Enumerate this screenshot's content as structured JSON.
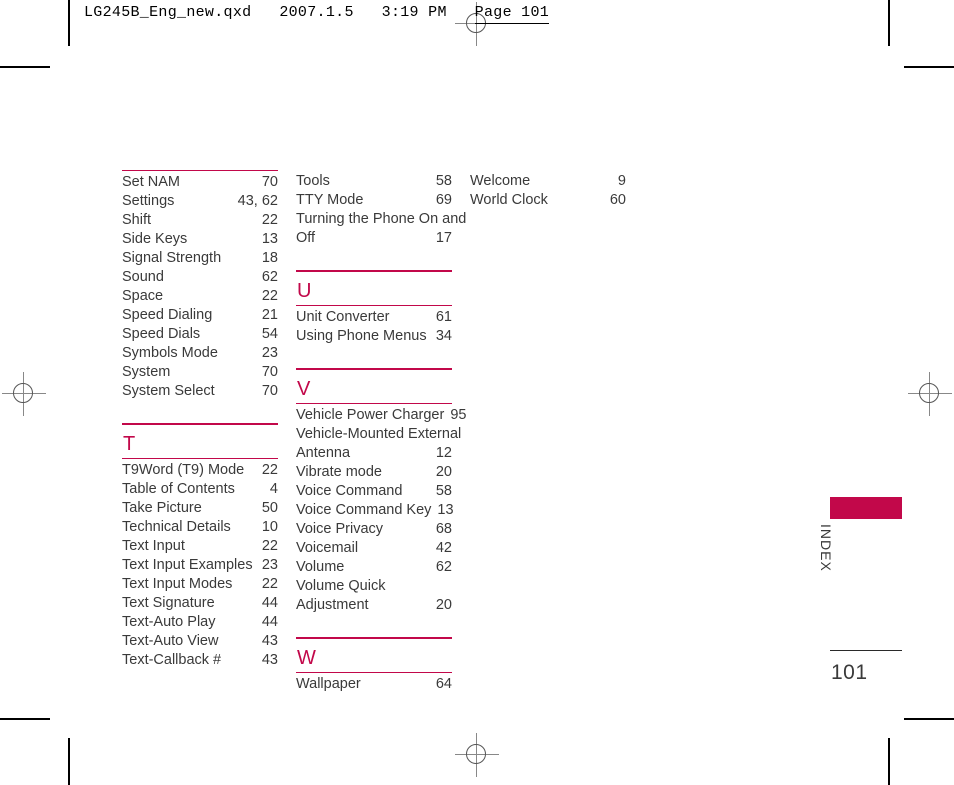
{
  "header": {
    "slug_main": "LG245B_Eng_new.qxd   2007.1.5   3:19 PM",
    "slug_page": "Page 101"
  },
  "sidebar": {
    "tab_label": "INDEX",
    "folio": "101",
    "accent_color": "#C2084A"
  },
  "columns": [
    {
      "blocks": [
        {
          "kind": "entries",
          "top_rule": "thin",
          "entries": [
            {
              "term": "Set NAM",
              "page": "70"
            },
            {
              "term": "Settings",
              "page": "43, 62"
            },
            {
              "term": "Shift",
              "page": "22"
            },
            {
              "term": "Side Keys",
              "page": "13"
            },
            {
              "term": "Signal Strength",
              "page": "18"
            },
            {
              "term": "Sound",
              "page": "62"
            },
            {
              "term": "Space",
              "page": "22"
            },
            {
              "term": "Speed Dialing",
              "page": "21"
            },
            {
              "term": "Speed Dials",
              "page": "54"
            },
            {
              "term": "Symbols Mode",
              "page": "23"
            },
            {
              "term": "System",
              "page": "70"
            },
            {
              "term": "System Select",
              "page": "70"
            }
          ]
        },
        {
          "kind": "section",
          "letter": "T",
          "entries": [
            {
              "term": "T9Word (T9) Mode",
              "page": "22"
            },
            {
              "term": "Table of Contents",
              "page": "4"
            },
            {
              "term": "Take Picture",
              "page": "50"
            },
            {
              "term": "Technical Details",
              "page": "10"
            },
            {
              "term": "Text Input",
              "page": "22"
            },
            {
              "term": "Text Input Examples",
              "page": "23"
            },
            {
              "term": "Text Input Modes",
              "page": "22"
            },
            {
              "term": "Text Signature",
              "page": "44"
            },
            {
              "term": "Text-Auto Play",
              "page": "44"
            },
            {
              "term": "Text-Auto View",
              "page": "43"
            },
            {
              "term": "Text-Callback #",
              "page": "43"
            }
          ]
        }
      ]
    },
    {
      "blocks": [
        {
          "kind": "entries",
          "top_rule": "none",
          "entries": [
            {
              "term": "Tools",
              "page": "58"
            },
            {
              "term": "TTY Mode",
              "page": "69"
            },
            {
              "term": "Turning the Phone On and",
              "term2": "Off",
              "page": "17",
              "wrapped": true
            }
          ]
        },
        {
          "kind": "section",
          "letter": "U",
          "entries": [
            {
              "term": "Unit Converter",
              "page": "61"
            },
            {
              "term": "Using Phone Menus",
              "page": "34"
            }
          ]
        },
        {
          "kind": "section",
          "letter": "V",
          "entries": [
            {
              "term": "Vehicle Power Charger",
              "page": "95"
            },
            {
              "term": "Vehicle-Mounted External",
              "term2": "Antenna",
              "page": "12",
              "wrapped": true
            },
            {
              "term": "Vibrate mode",
              "page": "20"
            },
            {
              "term": "Voice Command",
              "page": "58"
            },
            {
              "term": "Voice Command Key",
              "page": "13"
            },
            {
              "term": "Voice Privacy",
              "page": "68"
            },
            {
              "term": "Voicemail",
              "page": "42"
            },
            {
              "term": "Volume",
              "page": "62"
            },
            {
              "term": "Volume Quick",
              "term2": "Adjustment",
              "page": "20",
              "wrapped": true
            }
          ]
        },
        {
          "kind": "section",
          "letter": "W",
          "entries": [
            {
              "term": "Wallpaper",
              "page": "64"
            }
          ]
        }
      ]
    },
    {
      "blocks": [
        {
          "kind": "entries",
          "top_rule": "none",
          "entries": [
            {
              "term": "Welcome",
              "page": "9"
            },
            {
              "term": "World Clock",
              "page": "60"
            }
          ]
        }
      ]
    }
  ]
}
